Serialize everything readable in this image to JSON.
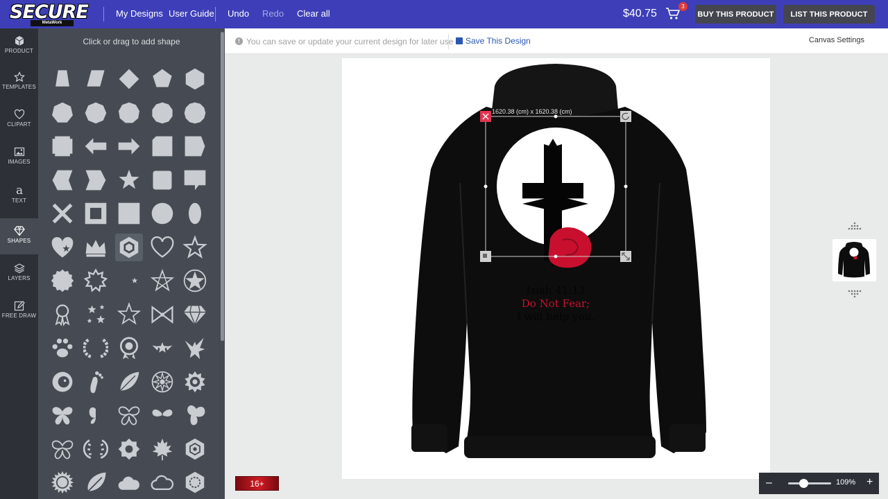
{
  "header": {
    "logo_text": "SECURE",
    "logo_sub": "MetaWork",
    "my_designs": "My Designs",
    "user_guide": "User Guide",
    "undo": "Undo",
    "redo": "Redo",
    "clear_all": "Clear all",
    "price": "$40.75",
    "cart_count": "3",
    "buy_button": "BUY THIS PRODUCT",
    "list_button": "LIST THIS PRODUCT"
  },
  "sidebar": {
    "items": [
      {
        "label": "PRODUCT",
        "icon": "cube-icon"
      },
      {
        "label": "TEMPLATES",
        "icon": "star-outline-icon"
      },
      {
        "label": "CLIPART",
        "icon": "heart-outline-icon"
      },
      {
        "label": "IMAGES",
        "icon": "image-icon"
      },
      {
        "label": "TEXT",
        "icon": "text-a-icon"
      },
      {
        "label": "SHAPES",
        "icon": "diamond-icon",
        "active": true
      },
      {
        "label": "LAYERS",
        "icon": "layers-icon"
      },
      {
        "label": "FREE DRAW",
        "icon": "pencil-icon"
      }
    ]
  },
  "panel": {
    "title": "Click or drag to add shape"
  },
  "infobar": {
    "message": "You can save or update your current design for later use",
    "save_link": "Save This Design",
    "canvas_settings": "Canvas Settings"
  },
  "design": {
    "dimensions": "1620.38 (cm) x 1620.38 (cm)",
    "text_line1": "Isiah 41:13",
    "text_line2": "Do Not Fear;",
    "text_line3": "I will help you.",
    "accent_red": "#c8102e"
  },
  "footer": {
    "age_badge": "16+",
    "zoom": "109%",
    "zoom_level": 0.36
  }
}
